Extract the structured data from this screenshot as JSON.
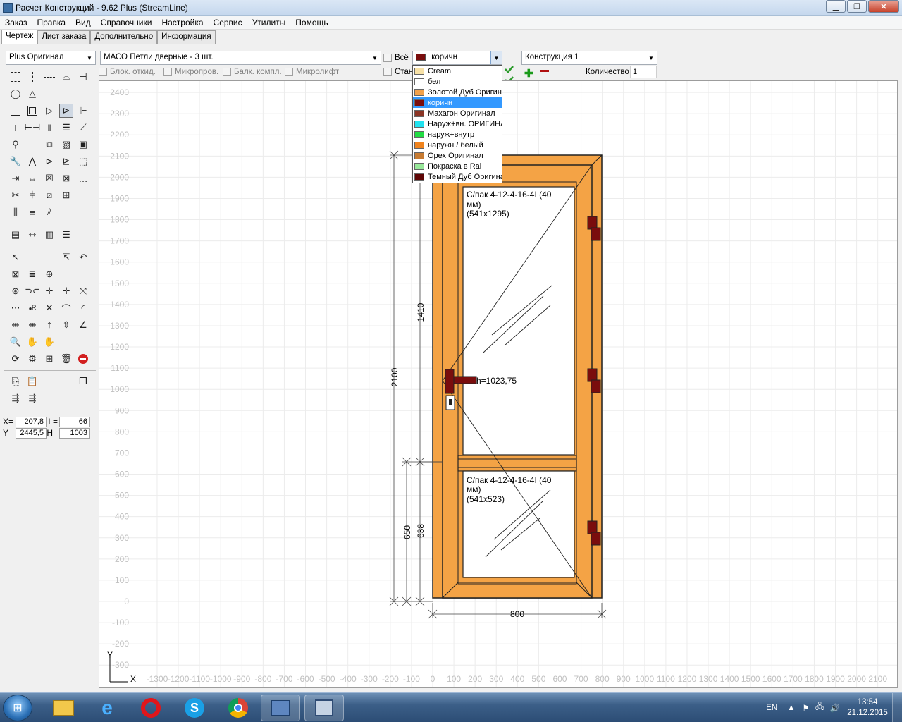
{
  "window": {
    "title": "Расчет Конструкций - 9.62 Plus (StreamLine)"
  },
  "menu": [
    "Заказ",
    "Правка",
    "Вид",
    "Справочники",
    "Настройка",
    "Сервис",
    "Утилиты",
    "Помощь"
  ],
  "tabs": [
    "Чертеж",
    "Лист заказа",
    "Дополнительно",
    "Информация"
  ],
  "profile_combo": "Plus Оригинал",
  "hardware_combo": "МАСО Петли дверные - 3 шт.",
  "all_checkbox": "Всё",
  "color_combo": "коричн",
  "construction_combo": "Конструкция 1",
  "options": {
    "blok": "Блок. откид.",
    "micro": "Микропров.",
    "balk": "Балк. компл.",
    "microlift": "Микролифт",
    "stan": "Стан"
  },
  "quantity": {
    "label": "Количество",
    "value": "1"
  },
  "color_list": [
    {
      "label": "Cream",
      "color": "#f7e1a6"
    },
    {
      "label": "бел",
      "color": "#ffffff"
    },
    {
      "label": "Золотой Дуб Оригин",
      "color": "#f2a14a"
    },
    {
      "label": "коричн",
      "color": "#7a0d0d"
    },
    {
      "label": "Махагон Оригинал",
      "color": "#8b3525"
    },
    {
      "label": "Наруж+вн. ОРИГИНА",
      "color": "#21e3f0"
    },
    {
      "label": "наруж+внутр",
      "color": "#22dd44"
    },
    {
      "label": "наружн / белый",
      "color": "#f0831d"
    },
    {
      "label": "Орех Оригинал",
      "color": "#c77b32"
    },
    {
      "label": "Покраска в Ral",
      "color": "#98e89a"
    },
    {
      "label": "Темный Дуб Оригина",
      "color": "#5e0505"
    }
  ],
  "selected_color": "коричн",
  "coords": {
    "x_label": "X=",
    "x": "207,8",
    "l_label": "L=",
    "l": "66",
    "y_label": "Y=",
    "y": "2445,5",
    "h_label": "H=",
    "h": "1003"
  },
  "drawing": {
    "y_ticks": [
      "2400",
      "2300",
      "2200",
      "2100",
      "2000",
      "1900",
      "1800",
      "1700",
      "1600",
      "1500",
      "1400",
      "1300",
      "1200",
      "1100",
      "1000",
      "900",
      "800",
      "700",
      "600",
      "500",
      "400",
      "300",
      "200",
      "100",
      "0",
      "-100",
      "-200",
      "-300"
    ],
    "x_ticks": [
      "0",
      "100",
      "200",
      "300",
      "400",
      "500",
      "600",
      "700",
      "800",
      "900",
      "1000",
      "1100",
      "1200",
      "1300",
      "1400",
      "1500",
      "1600",
      "1700",
      "1800",
      "1900",
      "2000",
      "2100"
    ],
    "x_neg_ticks": [
      "-100",
      "-200",
      "-300",
      "-400",
      "-500",
      "-600",
      "-700",
      "-800",
      "-900",
      "-1000",
      "-1100",
      "-1200",
      "-1300"
    ],
    "x_axis_label": "X",
    "y_axis_label": "Y",
    "dim_width": "800",
    "dim_height": "2100",
    "dim_top_glass": "1410",
    "dim_bottom_650": "650",
    "dim_bottom_638": "638",
    "handle_height": "h=1023,75",
    "glass_top": [
      "С/пак  4-12-4-16-4І (40",
      "мм)",
      "(541x1295)"
    ],
    "glass_bottom": [
      "С/пак  4-12-4-16-4І (40",
      "мм)",
      "(541x523)"
    ],
    "frame_color": "#f4a345",
    "hinge_color": "#7a0d0d"
  },
  "taskbar": {
    "lang": "EN",
    "time": "13:54",
    "date": "21.12.2015"
  }
}
